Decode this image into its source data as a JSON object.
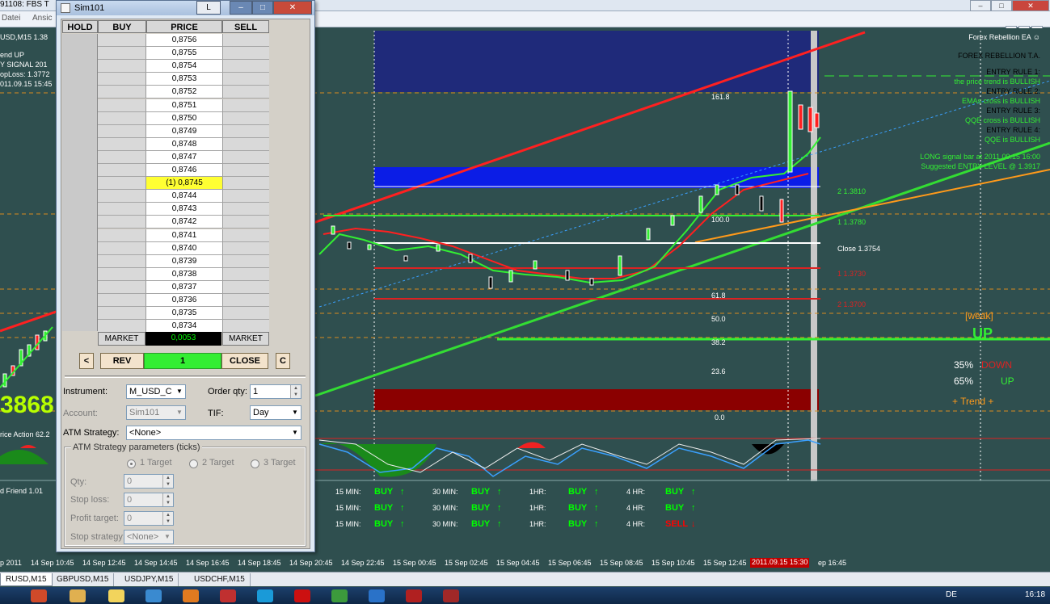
{
  "platform": {
    "title": "91108: FBS T",
    "menu": [
      "Datei",
      "Ansic"
    ],
    "left_info": {
      "symbol": "USD,M15  1.38",
      "trend": "end UP",
      "signal": "Y SIGNAL  201",
      "stoploss": "opLoss: 1.3772",
      "date": "011.09.15 15:45",
      "big_price": "3868",
      "price_action": "rice Action 62.2",
      "friend": "d Friend 1.01"
    }
  },
  "dom": {
    "title": "Sim101",
    "ctrl_l": "L",
    "headers": {
      "hold": "HOLD",
      "buy": "BUY",
      "price": "PRICE",
      "sell": "SELL"
    },
    "prices": [
      "0,8756",
      "0,8755",
      "0,8754",
      "0,8753",
      "0,8752",
      "0,8751",
      "0,8750",
      "0,8749",
      "0,8748",
      "0,8747",
      "0,8746",
      "(1) 0,8745",
      "0,8744",
      "0,8743",
      "0,8742",
      "0,8741",
      "0,8740",
      "0,8739",
      "0,8738",
      "0,8737",
      "0,8736",
      "0,8735",
      "0,8734"
    ],
    "current_index": 11,
    "market_buy": "MARKET",
    "market_sell": "MARKET",
    "pnl": "0,0053",
    "btn_left": "<",
    "btn_rev": "REV",
    "qty": "1",
    "btn_close": "CLOSE",
    "btn_c": "C",
    "instrument_label": "Instrument:",
    "instrument_value": "M_USD_C",
    "order_qty_label": "Order qty:",
    "order_qty_value": "1",
    "account_label": "Account:",
    "account_value": "Sim101",
    "tif_label": "TIF:",
    "tif_value": "Day",
    "atm_label": "ATM Strategy:",
    "atm_value": "<None>",
    "atm_params_title": "ATM Strategy parameters (ticks)",
    "targets": [
      "1 Target",
      "2 Target",
      "3 Target"
    ],
    "qty_label": "Qty:",
    "qty_value": "0",
    "stop_loss_label": "Stop loss:",
    "stop_loss_value": "0",
    "profit_target_label": "Profit target:",
    "profit_target_value": "0",
    "stop_strategy_label": "Stop strategy:",
    "stop_strategy_value": "<None>"
  },
  "chart": {
    "levels": {
      "fib_161": "161.8",
      "fib_100": "100.0",
      "fib_61": "61.8",
      "fib_50": "50.0",
      "fib_38": "38.2",
      "fib_23": "23.6",
      "fib_0": "0.0",
      "r2": "2 1.3810",
      "r1": "1 1.3780",
      "close": "Close  1.3754",
      "s1": "1 1.3730",
      "s2": "2 1.3700"
    },
    "ea": {
      "name": "Forex Rebellion EA ☺",
      "header": "FOREX REBELLION T.A.",
      "rule1": "ENTRY RULE 1:",
      "rule1_text": "the price trend is BULLISH",
      "rule2": "ENTRY RULE 2:",
      "rule2_text": "EMAs cross is BULLISH",
      "rule3": "ENTRY RULE 3:",
      "rule3_text": "QQE cross is BULLISH",
      "rule4": "ENTRY RULE 4:",
      "rule4_text": "QQE is BULLISH",
      "signal": "LONG signal bar at 2011.09.15 16:00",
      "entry": "Suggested ENTRY LEVEL @ 1.3917"
    },
    "strength": {
      "weak": "[weak]",
      "up": "UP",
      "down_pct": "35%",
      "down": "DOWN",
      "up_pct": "65%",
      "up2": "UP",
      "trend": "+   Trend   +"
    },
    "mtf": [
      [
        {
          "tf": "15 MIN:",
          "sig": "BUY"
        },
        {
          "tf": "30 MIN:",
          "sig": "BUY"
        },
        {
          "tf": "1HR:",
          "sig": "BUY"
        },
        {
          "tf": "4 HR:",
          "sig": "BUY"
        }
      ],
      [
        {
          "tf": "15 MIN:",
          "sig": "BUY"
        },
        {
          "tf": "30 MIN:",
          "sig": "BUY"
        },
        {
          "tf": "1HR:",
          "sig": "BUY"
        },
        {
          "tf": "4 HR:",
          "sig": "BUY"
        }
      ],
      [
        {
          "tf": "15 MIN:",
          "sig": "BUY"
        },
        {
          "tf": "30 MIN:",
          "sig": "BUY"
        },
        {
          "tf": "1HR:",
          "sig": "BUY"
        },
        {
          "tf": "4 HR:",
          "sig": "SELL"
        }
      ]
    ],
    "time_labels": [
      "p 2011",
      "14 Sep 10:45",
      "14 Sep 12:45",
      "14 Sep 14:45",
      "14 Sep 16:45",
      "14 Sep 18:45",
      "14 Sep 20:45",
      "14 Sep 22:45",
      "15 Sep 00:45",
      "15 Sep 02:45",
      "15 Sep 04:45",
      "15 Sep 06:45",
      "15 Sep 08:45",
      "15 Sep 10:45",
      "15 Sep 12:45"
    ],
    "time_marker": "2011.09.15 15:30",
    "time_last": "ep 16:45"
  },
  "tabs": [
    "RUSD,M15",
    "GBPUSD,M15",
    "USDJPY,M15",
    "USDCHF,M15"
  ],
  "tray": {
    "lang": "DE",
    "clock": "16:18"
  },
  "colors": {
    "chart_bg": "#2f4f4f",
    "bull": "#00ff00",
    "bear": "#ff0000",
    "pnl_bg": "#000000",
    "qty_bar": "#33ee33"
  }
}
